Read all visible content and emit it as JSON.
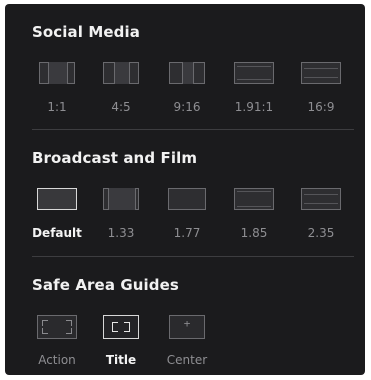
{
  "sections": {
    "social": {
      "title": "Social Media",
      "options": [
        {
          "label": "1:1"
        },
        {
          "label": "4:5"
        },
        {
          "label": "9:16"
        },
        {
          "label": "1.91:1"
        },
        {
          "label": "16:9"
        }
      ]
    },
    "broadcast": {
      "title": "Broadcast and Film",
      "selected": "Default",
      "options": [
        {
          "label": "Default"
        },
        {
          "label": "1.33"
        },
        {
          "label": "1.77"
        },
        {
          "label": "1.85"
        },
        {
          "label": "2.35"
        }
      ]
    },
    "safe": {
      "title": "Safe Area Guides",
      "selected": "Title",
      "options": [
        {
          "label": "Action"
        },
        {
          "label": "Title"
        },
        {
          "label": "Center",
          "glyph": "+"
        }
      ]
    }
  },
  "colors": {
    "panel": "#1b1b1d",
    "selected_text": "#f4f4f4",
    "unselected_text": "#8e8e92"
  }
}
